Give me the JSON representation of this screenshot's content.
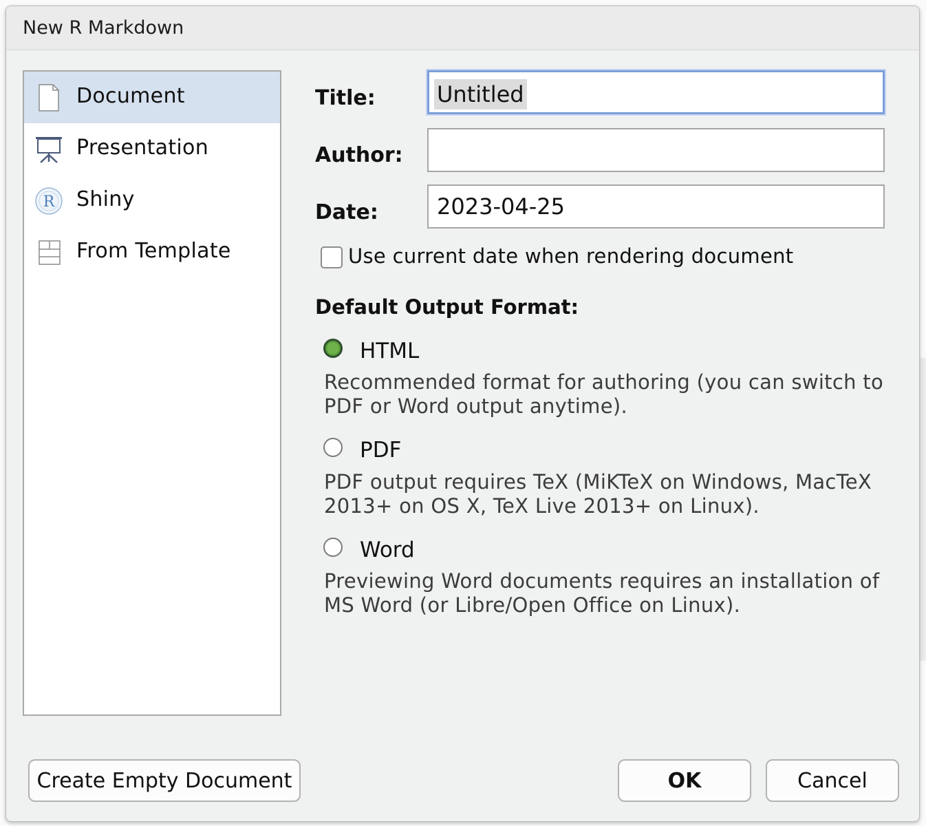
{
  "dialog": {
    "title": "New R Markdown"
  },
  "sidebar": {
    "items": [
      {
        "label": "Document",
        "icon": "document-icon",
        "selected": true
      },
      {
        "label": "Presentation",
        "icon": "presentation-icon",
        "selected": false
      },
      {
        "label": "Shiny",
        "icon": "shiny-r-icon",
        "selected": false
      },
      {
        "label": "From Template",
        "icon": "template-icon",
        "selected": false
      }
    ]
  },
  "form": {
    "title_label": "Title:",
    "title_value": "Untitled",
    "author_label": "Author:",
    "author_value": "",
    "date_label": "Date:",
    "date_value": "2023-04-25",
    "use_current_date_label": "Use current date when rendering document",
    "use_current_date_checked": false
  },
  "output_format": {
    "heading": "Default Output Format:",
    "options": [
      {
        "label": "HTML",
        "checked": true,
        "description": "Recommended format for authoring (you can switch to PDF or Word output anytime)."
      },
      {
        "label": "PDF",
        "checked": false,
        "description": "PDF output requires TeX (MiKTeX on Windows, MacTeX 2013+ on OS X, TeX Live 2013+ on Linux)."
      },
      {
        "label": "Word",
        "checked": false,
        "description": "Previewing Word documents requires an installation of MS Word (or Libre/Open Office on Linux)."
      }
    ]
  },
  "buttons": {
    "create_empty": "Create Empty Document",
    "ok": "OK",
    "cancel": "Cancel"
  },
  "colors": {
    "selected_row": "#d5e1ee",
    "focus_ring": "#7d9ed8",
    "radio_checked": "#6fb24b"
  }
}
